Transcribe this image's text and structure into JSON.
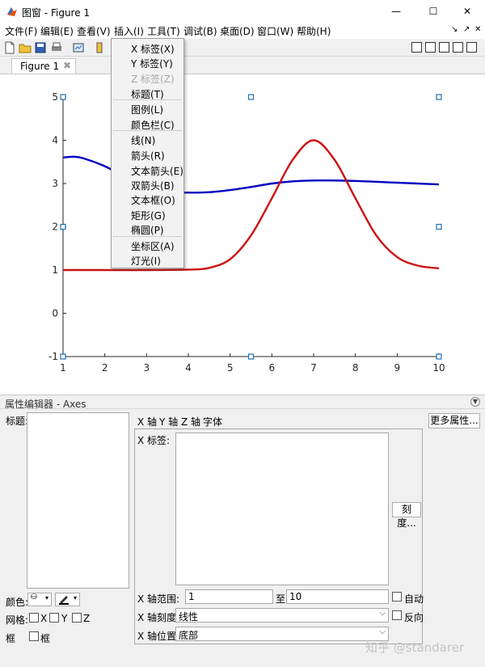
{
  "window": {
    "title": "图窗 - Figure 1",
    "controls": [
      "—",
      "☐",
      "✕"
    ]
  },
  "menubar": {
    "items": [
      "文件(F)",
      "编辑(E)",
      "查看(V)",
      "插入(I)",
      "工具(T)",
      "调试(B)",
      "桌面(D)",
      "窗口(W)",
      "帮助(H)"
    ],
    "dock_controls": [
      "↘",
      "↗",
      "✕"
    ]
  },
  "tab": {
    "label": "Figure 1",
    "close": "✖"
  },
  "insert_menu": {
    "items": [
      {
        "label": "X 标签(X)",
        "enabled": true
      },
      {
        "label": "Y 标签(Y)",
        "enabled": true
      },
      {
        "label": "Z 标签(Z)",
        "enabled": false
      },
      {
        "label": "标题(T)",
        "enabled": true
      },
      {
        "label": "图例(L)",
        "enabled": true
      },
      {
        "label": "颜色栏(C)",
        "enabled": true
      },
      {
        "label": "线(N)",
        "enabled": true
      },
      {
        "label": "箭头(R)",
        "enabled": true
      },
      {
        "label": "文本箭头(E)",
        "enabled": true
      },
      {
        "label": "双箭头(B)",
        "enabled": true
      },
      {
        "label": "文本框(O)",
        "enabled": true
      },
      {
        "label": "矩形(G)",
        "enabled": true
      },
      {
        "label": "椭圆(P)",
        "enabled": true
      },
      {
        "label": "坐标区(A)",
        "enabled": true
      },
      {
        "label": "灯光(I)",
        "enabled": true
      }
    ]
  },
  "chart_data": {
    "type": "line",
    "xlim": [
      1,
      10
    ],
    "ylim": [
      -1,
      5
    ],
    "xticks": [
      1,
      2,
      3,
      4,
      5,
      6,
      7,
      8,
      9,
      10
    ],
    "yticks": [
      -1,
      0,
      1,
      2,
      3,
      4,
      5
    ],
    "grid": false,
    "series": [
      {
        "color": "#0000c0",
        "x": [
          1,
          1.25,
          1.5,
          2,
          2.5,
          3,
          3.5,
          4,
          4.5,
          5,
          5.5,
          6,
          6.5,
          7,
          7.5,
          8,
          8.5,
          9,
          9.5,
          10
        ],
        "y": [
          3.6,
          3.62,
          3.58,
          3.4,
          3.15,
          2.93,
          2.82,
          2.79,
          2.8,
          2.85,
          2.92,
          3.0,
          3.05,
          3.07,
          3.07,
          3.06,
          3.04,
          3.02,
          3.0,
          2.98
        ]
      },
      {
        "color": "#cc1111",
        "x": [
          1,
          2,
          3,
          4,
          4.5,
          5,
          5.5,
          6,
          6.5,
          7,
          7.5,
          8,
          8.5,
          9,
          9.5,
          10
        ],
        "y": [
          1.0,
          1.0,
          1.0,
          1.01,
          1.05,
          1.25,
          1.8,
          2.66,
          3.55,
          4.0,
          3.55,
          2.66,
          1.8,
          1.3,
          1.1,
          1.04
        ]
      }
    ]
  },
  "property_editor": {
    "header": "属性编辑器 - Axes",
    "title_label": "标题:",
    "title_value": "",
    "color_label": "颜色:",
    "grid_label": "网格:",
    "grid_x": "X",
    "grid_y": "Y",
    "grid_z": "Z",
    "box_label": "框",
    "box_check_label": "框",
    "tabs": [
      "X 轴",
      "Y 轴",
      "Z 轴",
      "字体"
    ],
    "more_props": "更多属性...",
    "xlabel_label": "X 标签:",
    "xlabel_value": "",
    "ticks_button": "刻度...",
    "xrange_label": "X 轴范围:",
    "xrange_min": "1",
    "xrange_to": "至",
    "xrange_max": "10",
    "auto_label": "自动",
    "xscale_label": "X 轴刻度:",
    "xscale_value": "线性",
    "reverse_label": "反向",
    "xloc_label": "X 轴位置:",
    "xloc_value": "底部"
  },
  "watermark": "知乎 @standarer"
}
